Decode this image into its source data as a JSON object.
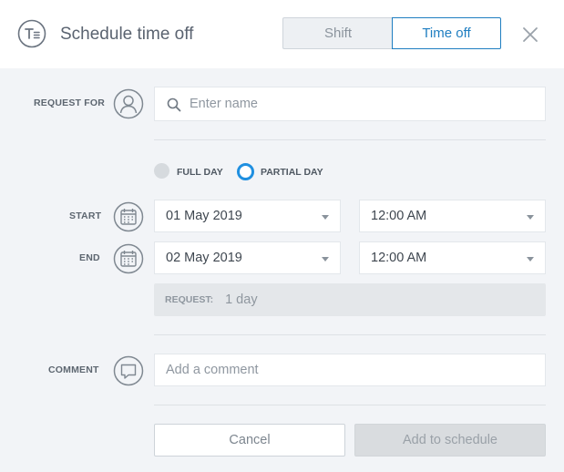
{
  "header": {
    "title": "Schedule time off",
    "tabs": [
      {
        "label": "Shift",
        "active": false
      },
      {
        "label": "Time off",
        "active": true
      }
    ],
    "close_icon": "close-icon",
    "accent_color": "#1f7ec1"
  },
  "form": {
    "request_for": {
      "label": "REQUEST FOR",
      "placeholder": "Enter name",
      "icon": "user-icon"
    },
    "duration": {
      "options": [
        {
          "label": "FULL DAY",
          "selected": false
        },
        {
          "label": "PARTIAL DAY",
          "selected": true
        }
      ]
    },
    "start": {
      "label": "START",
      "date": "01 May 2019",
      "time": "12:00 AM",
      "icon": "calendar-icon"
    },
    "end": {
      "label": "END",
      "date": "02 May 2019",
      "time": "12:00 AM",
      "icon": "calendar-icon"
    },
    "request_summary": {
      "label": "REQUEST:",
      "value": "1 day"
    },
    "comment": {
      "label": "COMMENT",
      "placeholder": "Add a comment",
      "icon": "comment-icon"
    }
  },
  "actions": {
    "cancel_label": "Cancel",
    "add_label": "Add to schedule"
  }
}
